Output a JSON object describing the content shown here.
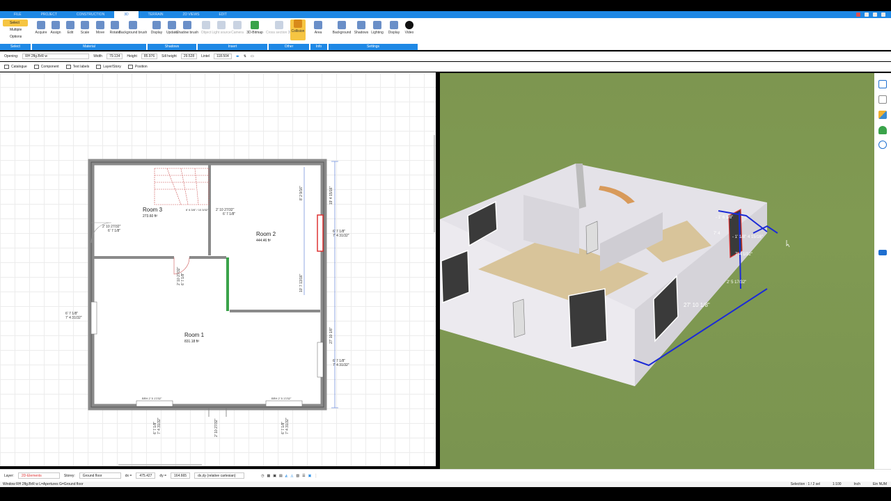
{
  "menu": {
    "tabs": [
      "File",
      "Project",
      "Construction",
      "3D",
      "Terrain",
      "2D Views",
      "Edit"
    ],
    "active_index": 3
  },
  "ribbon": {
    "select": {
      "select": "Select",
      "multiple": "Multiple",
      "options": "Options",
      "group": "Select"
    },
    "material": {
      "items": [
        "Acquire",
        "Assign",
        "Edit",
        "Scale",
        "Move",
        "Rotate",
        "Background brush"
      ],
      "group": "Material"
    },
    "shadows": {
      "items": [
        "Display",
        "Update",
        "Shadow brush"
      ],
      "group": "Shadows"
    },
    "insert": {
      "items": [
        "Object",
        "Light source",
        "Camera",
        "3D-Bitmap"
      ],
      "group": "Insert"
    },
    "other": {
      "items": [
        "Cross section 3D",
        "Collision"
      ],
      "group": "Other"
    },
    "info": {
      "items": [
        "Area"
      ],
      "group": "Info"
    },
    "settings": {
      "items": [
        "Background",
        "Shadows",
        "Lighting",
        "Display",
        "Video"
      ],
      "group": "Settings"
    }
  },
  "options": {
    "opening_label": "Opening:",
    "opening_value": "RH 2flg.BrR w",
    "width_label": "Width",
    "width_value": "79.134",
    "height_label": "Height",
    "height_value": "85.976",
    "sill_label": "Sill height",
    "sill_value": "29.528",
    "lintel_label": "Lintel",
    "lintel_value": "118.504"
  },
  "viewtabs": [
    "Catalogue",
    "Component",
    "Text labels",
    "Layer/Story",
    "Position"
  ],
  "plan": {
    "rooms": [
      {
        "name": "Room 3",
        "area": "273.60 ft²"
      },
      {
        "name": "Room 2",
        "area": "444.46 ft²"
      },
      {
        "name": "Room 1",
        "area": "831.18 ft²"
      }
    ],
    "dims": {
      "d1": "2' 10 27/32\"",
      "d2": "6' 7 1/8\"",
      "d3": "2' 10 27/32\"",
      "d4": "6' 7 1/8\"",
      "d5": "6' 6 3/8\" / 10 3/32\"",
      "d6": "6' 7 1/8\"",
      "d7": "7' 4 31/32\"",
      "d8": "7' 4 31/32\"",
      "d9": "2' 10 27/32\"",
      "d10": "6' 7 1/8\"",
      "d11": "BRH 2' 5 17/32\"",
      "d12": "BRH 2' 5 17/32\"",
      "d13": "6' 7 1/8\"",
      "d14": "7' 4 31/32\"",
      "d15": "2' 10 27/32\"",
      "d16": "6' 7 1/8\"",
      "d17": "7' 4 31/32\"",
      "d18": "19' 4 15/16\"",
      "d19": "27' 10 1/8\"",
      "d20": "8' 2 9/16\"",
      "d21": "10' 7 13/16\""
    }
  },
  "view3d": {
    "labels": {
      "a": "- 1' 6 1/8\"",
      "b": "7' 4",
      "c": "- 1' 1/8\"  4 15/16\"",
      "d": "7' 4 1/32\"",
      "e": "2' 5 17/32\"",
      "f": "27' 10 1/8\""
    }
  },
  "status": {
    "layer_label": "Layer:",
    "layer_value": "2D-Elements",
    "storey_label": "Storey:",
    "storey_value": "Ground floor",
    "dx_label": "dx =",
    "dx_value": "475.427",
    "dy_label": "dy =",
    "dy_value": "164.665",
    "mode_value": "dx,dy (relative cartesian)"
  },
  "footer": {
    "left": "Window RH 2flg.BrR w L=Apertures G=Ground floor",
    "selection": "Selection : 1 / 2 sel",
    "scale": "1:100",
    "unit": "Inch",
    "flags": "Ein  NUM"
  },
  "colors": {
    "accent": "#1e88e5",
    "highlight": "#f6c542",
    "grass": "#7f9852",
    "wall": "#e3e1e6"
  }
}
